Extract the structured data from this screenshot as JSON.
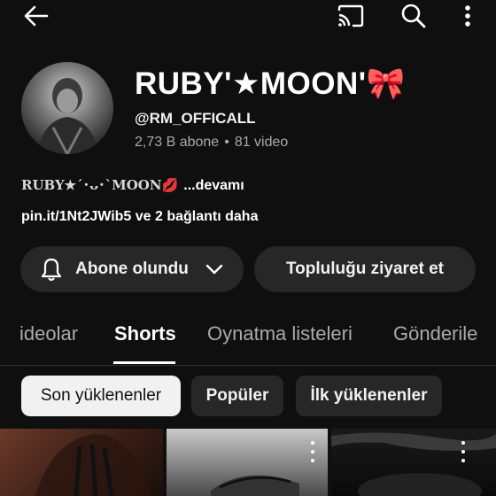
{
  "channel": {
    "title": "RUBY'★MOON'🎀",
    "handle": "@RM_OFFICALL",
    "subscribers": "2,73 B abone",
    "separator": "•",
    "videos": "81 video",
    "description_name": "RUBY★´･ᴗ･`MOON💋",
    "description_more": "...devamı",
    "links": "pin.it/1Nt2JWib5 ve 2 bağlantı daha"
  },
  "buttons": {
    "subscribed": "Abone olundu",
    "community": "Topluluğu ziyaret et"
  },
  "tabs": [
    {
      "label": "ideolar"
    },
    {
      "label": "Shorts",
      "active": true
    },
    {
      "label": "Oynatma listeleri"
    },
    {
      "label": "Gönderile"
    }
  ],
  "chips": [
    {
      "label": "Son yüklenenler",
      "selected": true
    },
    {
      "label": "Popüler"
    },
    {
      "label": "İlk yüklenenler"
    }
  ],
  "icons": [
    "back-arrow-icon",
    "cast-icon",
    "search-icon",
    "more-vert-icon",
    "bell-icon",
    "chevron-down-icon"
  ]
}
